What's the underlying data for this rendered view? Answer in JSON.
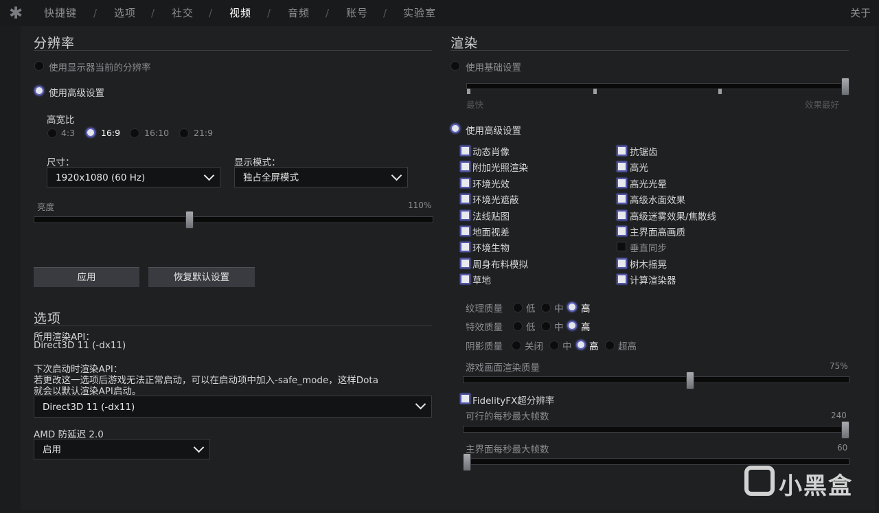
{
  "topbar": {
    "tabs": [
      "快捷键",
      "选项",
      "社交",
      "视频",
      "音频",
      "账号",
      "实验室"
    ],
    "active_tab": "视频",
    "separator": "/",
    "about": "关于"
  },
  "resolution": {
    "title": "分辨率",
    "use_monitor_label": "使用显示器当前的分辨率",
    "use_advanced_label": "使用高级设置",
    "aspect_label": "高宽比",
    "aspects": [
      "4:3",
      "16:9",
      "16:10",
      "21:9"
    ],
    "aspect_selected": "16:9",
    "size_label": "尺寸：",
    "size_value": "1920x1080 (60 Hz)",
    "display_mode_label": "显示模式：",
    "display_mode_value": "独占全屏模式",
    "brightness_label": "亮度",
    "brightness_value_text": "110%",
    "brightness_level": 0.39,
    "apply_button": "应用",
    "reset_button": "恢复默认设置"
  },
  "options": {
    "title": "选项",
    "api_label": "所用渲染API：",
    "api_value": "Direct3D 11 (-dx11)",
    "next_api_label": "下次启动时渲染API：",
    "next_api_note_1": "若更改这一选项后游戏无法正常启动，可以在启动项中加入-safe_mode，这样Dota",
    "next_api_note_2": "就会以默认渲染API启动。",
    "next_api_select": "Direct3D 11 (-dx11)",
    "amd_label": "AMD 防延迟 2.0",
    "amd_select": "启用"
  },
  "render": {
    "title": "渲染",
    "use_basic_label": "使用基础设置",
    "basic_left": "最快",
    "basic_right": "效果最好",
    "use_advanced_label": "使用高级设置",
    "checks_left": [
      {
        "label": "动态肖像",
        "on": true
      },
      {
        "label": "附加光照渲染",
        "on": true
      },
      {
        "label": "环境光效",
        "on": true
      },
      {
        "label": "环境光遮蔽",
        "on": true
      },
      {
        "label": "法线贴图",
        "on": true
      },
      {
        "label": "地面视差",
        "on": true
      },
      {
        "label": "环境生物",
        "on": true
      },
      {
        "label": "周身布料模拟",
        "on": true
      },
      {
        "label": "草地",
        "on": true
      }
    ],
    "checks_right": [
      {
        "label": "抗锯齿",
        "on": true
      },
      {
        "label": "高光",
        "on": true
      },
      {
        "label": "高光光晕",
        "on": true
      },
      {
        "label": "高级水面效果",
        "on": true
      },
      {
        "label": "高级迷雾效果/焦散线",
        "on": true
      },
      {
        "label": "主界面高画质",
        "on": true
      },
      {
        "label": "垂直同步",
        "on": false
      },
      {
        "label": "树木摇晃",
        "on": true
      },
      {
        "label": "计算渲染器",
        "on": true
      }
    ],
    "texture_label": "纹理质量",
    "effects_label": "特效质量",
    "shadow_label": "阴影质量",
    "q_low": "低",
    "q_mid": "中",
    "q_high": "高",
    "s_off": "关闭",
    "s_mid": "中",
    "s_high": "高",
    "s_ultra": "超高",
    "render_quality_label": "游戏画面渲染质量",
    "render_quality_text": "75%",
    "fsr_label": "FidelityFX超分辨率",
    "max_fps_label": "可行的每秒最大帧数",
    "max_fps_value": "240",
    "menu_fps_label": "主界面每秒最大帧数",
    "menu_fps_value": "60"
  },
  "watermark": "小黑盒"
}
